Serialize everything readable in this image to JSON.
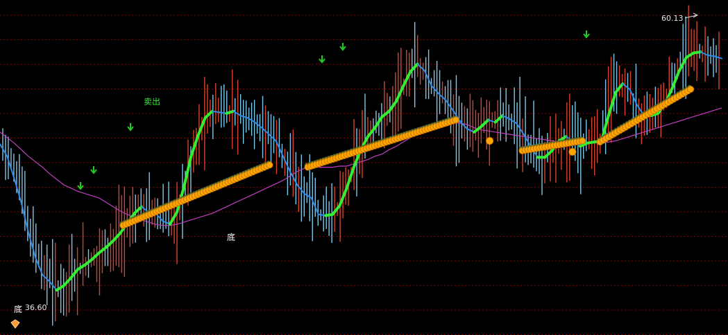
{
  "chart_data": {
    "type": "candlestick",
    "title": "",
    "xlabel": "",
    "ylabel": "",
    "ylim": [
      34,
      63
    ],
    "grid": true,
    "colors": {
      "background": "#000000",
      "grid": "#8b0000",
      "up_bar": "#d2442e",
      "down_bar": "#7fc8e8",
      "trend_up": "#33ee33",
      "trend_down": "#2f8ce8",
      "moving_average": "#c040c0",
      "support_dots": "#ffa500",
      "signal_arrow": "#22cc22"
    },
    "annotations": {
      "high_label": "60.13",
      "low_label": "36.60",
      "sell_label": "卖出",
      "bottom_label": "底",
      "bottom_label_2": "底"
    },
    "series": [
      {
        "label": "price",
        "values": [
          50.5,
          49.4,
          47.4,
          45.2,
          42.5,
          40.2,
          38.6,
          38.0,
          37.2,
          37.6,
          38.3,
          39.1,
          39.5,
          40.0,
          40.6,
          41.1,
          41.7,
          42.4,
          43.3,
          44.2,
          44.8,
          44.3,
          44.2,
          43.5,
          43.2,
          44.3,
          46.6,
          49.4,
          51.3,
          52.9,
          53.5,
          53.4,
          53.3,
          53.5,
          53.1,
          52.9,
          52.5,
          52.0,
          51.4,
          50.8,
          49.4,
          48.0,
          46.8,
          46.0,
          45.6,
          44.1,
          44.0,
          44.1,
          44.9,
          46.5,
          48.4,
          50.0,
          51.2,
          52.0,
          53.0,
          53.5,
          54.4,
          55.8,
          57.1,
          57.8,
          57.2,
          55.8,
          55.1,
          54.5,
          53.6,
          52.6,
          51.9,
          51.6,
          52.1,
          52.7,
          52.5,
          53.1,
          52.8,
          52.4,
          51.4,
          50.3,
          49.3,
          49.3,
          49.9,
          50.8,
          51.2,
          50.8,
          50.3,
          50.6,
          50.7,
          50.8,
          53.1,
          55.2,
          56.0,
          55.5,
          54.1,
          53.1,
          53.1,
          53.3,
          54.2,
          55.6,
          57.2,
          58.4,
          58.8,
          58.9,
          58.6,
          58.5,
          58.3
        ]
      },
      {
        "label": "moving_average",
        "values": [
          51.6,
          51.1,
          50.6,
          50.0,
          49.4,
          48.9,
          48.4,
          47.8,
          47.3,
          46.8,
          46.5,
          46.2,
          46.0,
          45.8,
          45.6,
          45.2,
          44.8,
          44.4,
          44.1,
          43.8,
          43.6,
          43.4,
          43.2,
          43.1,
          43.1,
          43.2,
          43.4,
          43.6,
          43.8,
          44.0,
          44.2,
          44.5,
          44.8,
          45.1,
          45.4,
          45.7,
          46.0,
          46.3,
          46.6,
          46.9,
          47.2,
          47.6,
          48.0,
          48.3,
          48.4,
          48.4,
          48.4,
          48.4,
          48.5,
          48.5,
          48.7,
          48.9,
          49.1,
          49.4,
          49.6,
          50.0,
          50.3,
          50.7,
          51.1,
          51.5,
          51.9,
          52.3,
          52.5,
          52.5,
          52.5,
          52.4,
          52.3,
          52.0,
          51.8,
          51.7,
          51.6,
          51.5,
          51.4,
          51.3,
          51.2,
          51.1,
          51.0,
          50.9,
          50.8,
          50.7,
          50.6,
          50.6,
          50.6,
          50.6,
          50.6,
          50.6,
          50.7,
          50.8,
          51.0,
          51.2,
          51.4,
          51.6,
          51.8,
          52.0,
          52.2,
          52.4,
          52.6,
          52.8,
          53.0,
          53.2,
          53.4,
          53.6,
          53.8
        ]
      }
    ],
    "support_dots": [
      {
        "start": 17.4,
        "end": 38.1,
        "from": 43.1,
        "to": 48.6
      },
      {
        "start": 43.5,
        "end": 64.4,
        "from": 48.4,
        "to": 52.7
      },
      {
        "start": 73.8,
        "end": 82.3,
        "from": 49.9,
        "to": 50.8
      },
      {
        "start": 84.8,
        "end": 97.6,
        "from": 50.7,
        "to": 55.5
      }
    ]
  }
}
